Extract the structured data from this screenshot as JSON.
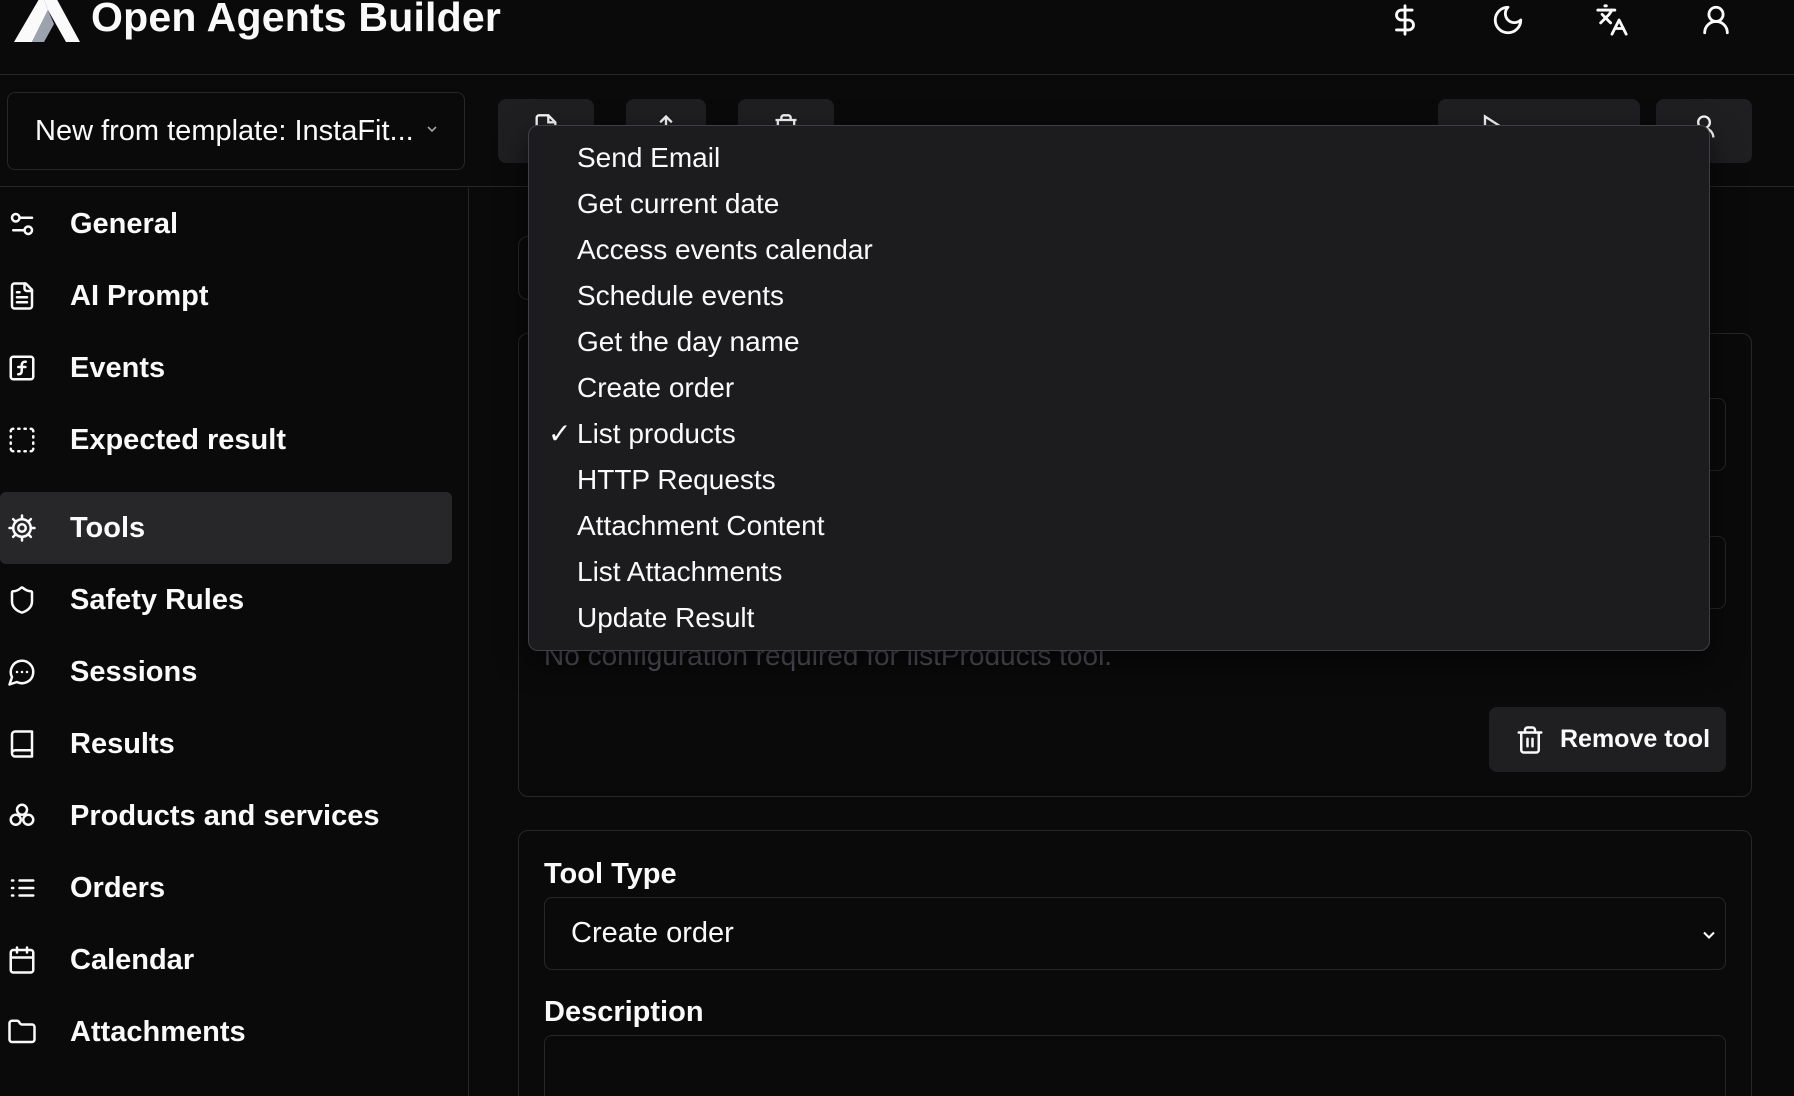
{
  "header": {
    "app_title": "Open Agents Builder",
    "icons": [
      "dollar-icon",
      "moon-icon",
      "language-icon",
      "user-icon"
    ]
  },
  "toolbar": {
    "template_select_value": "New from template: InstaFit...",
    "buttons": [
      "file-icon",
      "upload-icon",
      "trash-icon",
      "play-icon",
      "user-icon"
    ]
  },
  "sidebar": {
    "items": [
      {
        "label": "General",
        "icon": "sliders-icon"
      },
      {
        "label": "AI Prompt",
        "icon": "document-icon"
      },
      {
        "label": "Events",
        "icon": "function-icon"
      },
      {
        "label": "Expected result",
        "icon": "dashed-square-icon"
      },
      {
        "label": "Tools",
        "icon": "cog-icon",
        "active": true
      },
      {
        "label": "Safety Rules",
        "icon": "shield-icon"
      },
      {
        "label": "Sessions",
        "icon": "chat-icon"
      },
      {
        "label": "Results",
        "icon": "book-icon"
      },
      {
        "label": "Products and services",
        "icon": "boxes-icon"
      },
      {
        "label": "Orders",
        "icon": "list-icon"
      },
      {
        "label": "Calendar",
        "icon": "calendar-icon"
      },
      {
        "label": "Attachments",
        "icon": "folder-icon"
      }
    ]
  },
  "tool_card_1": {
    "config_note": "No configuration required for listProducts tool.",
    "remove_label": "Remove tool"
  },
  "tool_card_2": {
    "tool_type_label": "Tool Type",
    "tool_type_value": "Create order",
    "description_label": "Description"
  },
  "dropdown": {
    "selected": "List products",
    "check_glyph": "✓",
    "options": [
      "Send Email",
      "Get current date",
      "Access events calendar",
      "Schedule events",
      "Get the day name",
      "Create order",
      "List products",
      "HTTP Requests",
      "Attachment Content",
      "List Attachments",
      "Update Result"
    ]
  },
  "colors": {
    "background": "#0a0a0a",
    "border": "#27272a",
    "active_item": "#27272a",
    "dropdown_bg": "#1c1c1f",
    "text": "#fafafa",
    "muted": "#52525b"
  }
}
